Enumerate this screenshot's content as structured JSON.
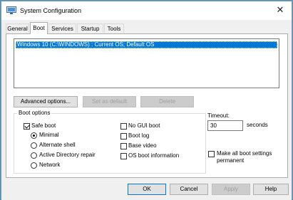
{
  "window": {
    "title": "System Configuration",
    "close_glyph": "✕"
  },
  "tabs": [
    {
      "label": "General"
    },
    {
      "label": "Boot"
    },
    {
      "label": "Services"
    },
    {
      "label": "Startup"
    },
    {
      "label": "Tools"
    }
  ],
  "active_tab": "Boot",
  "os_list": {
    "items": [
      "Windows 10 (C:\\WINDOWS) : Current OS; Default OS"
    ],
    "selected_index": 0
  },
  "buttons": {
    "advanced": "Advanced options...",
    "set_default": "Set as default",
    "delete": "Delete"
  },
  "boot_options": {
    "group_label": "Boot options",
    "safe_boot": {
      "label": "Safe boot",
      "checked": true
    },
    "radios": [
      {
        "label": "Minimal",
        "checked": true
      },
      {
        "label": "Alternate shell",
        "checked": false
      },
      {
        "label": "Active Directory repair",
        "checked": false
      },
      {
        "label": "Network",
        "checked": false
      }
    ],
    "checkboxes": [
      {
        "label": "No GUI boot",
        "checked": false
      },
      {
        "label": "Boot log",
        "checked": false
      },
      {
        "label": "Base video",
        "checked": false
      },
      {
        "label": "OS boot information",
        "checked": false
      }
    ]
  },
  "timeout": {
    "label": "Timeout:",
    "value": "30",
    "unit": "seconds"
  },
  "permanent": {
    "label_line1": "Make all boot settings",
    "label_line2": "permanent",
    "checked": false
  },
  "dialog_buttons": {
    "ok": "OK",
    "cancel": "Cancel",
    "apply": "Apply",
    "help": "Help"
  },
  "colors": {
    "selection": "#0078d7",
    "desktop": "#5b8fb0"
  }
}
